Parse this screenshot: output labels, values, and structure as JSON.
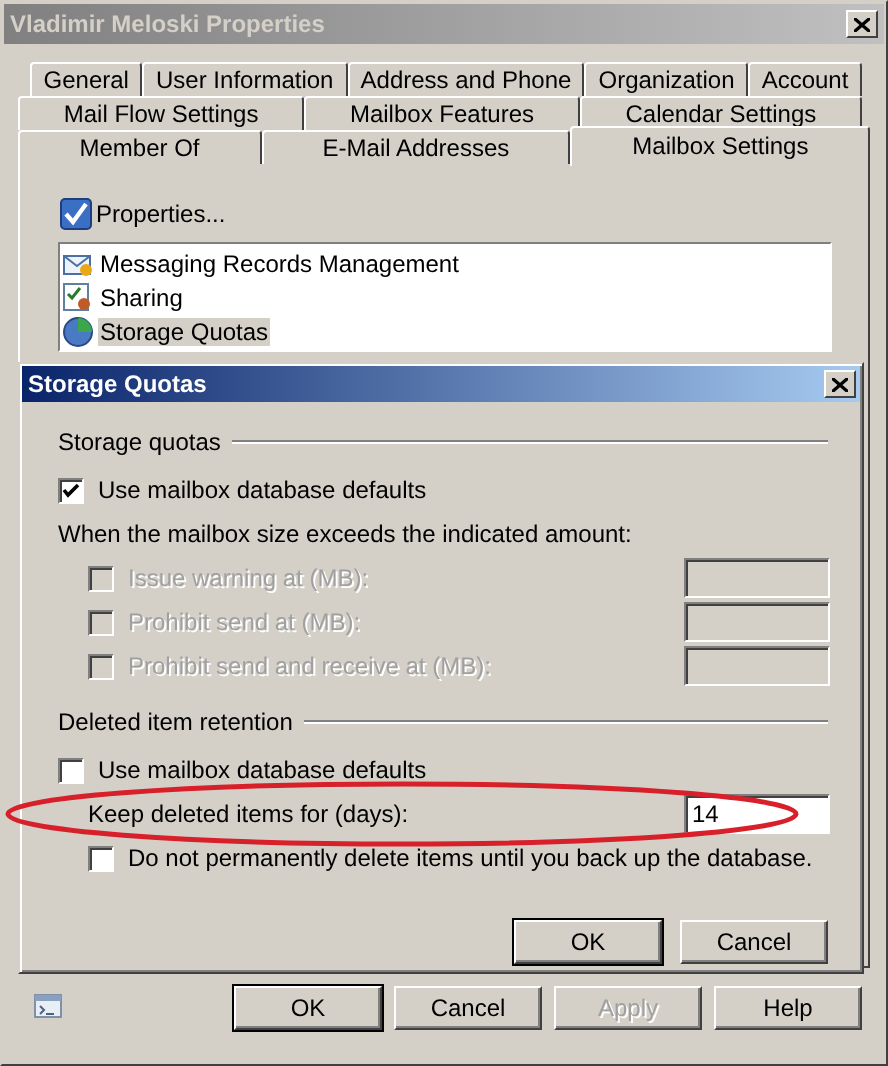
{
  "window": {
    "title": "Vladimir Meloski Properties"
  },
  "tab_rows": [
    [
      {
        "label": "General",
        "selected": false
      },
      {
        "label": "User Information",
        "selected": false
      },
      {
        "label": "Address and Phone",
        "selected": false
      },
      {
        "label": "Organization",
        "selected": false
      },
      {
        "label": "Account",
        "selected": false
      }
    ],
    [
      {
        "label": "Mail Flow Settings",
        "selected": false
      },
      {
        "label": "Mailbox Features",
        "selected": false
      },
      {
        "label": "Calendar Settings",
        "selected": false
      }
    ],
    [
      {
        "label": "Member Of",
        "selected": false
      },
      {
        "label": "E-Mail Addresses",
        "selected": false
      },
      {
        "label": "Mailbox Settings",
        "selected": true
      }
    ]
  ],
  "properties_button": {
    "label": "Properties..."
  },
  "list": [
    {
      "kind": "records",
      "label": "Messaging Records Management",
      "selected": false
    },
    {
      "kind": "sharing",
      "label": "Sharing",
      "selected": false
    },
    {
      "kind": "quota",
      "label": "Storage Quotas",
      "selected": true
    }
  ],
  "dialog": {
    "title": "Storage Quotas",
    "sections": [
      {
        "title": "Storage quotas",
        "items": [
          {
            "kind": "checkbox",
            "label": "Use mailbox database defaults",
            "checked": true,
            "disabled": false,
            "indented": false
          },
          {
            "kind": "text",
            "label": "When the mailbox size exceeds the indicated amount:"
          },
          {
            "kind": "check_field",
            "label": "Issue warning at (MB):",
            "checked": false,
            "disabled": true
          },
          {
            "kind": "check_field",
            "label": "Prohibit send at (MB):",
            "checked": false,
            "disabled": true
          },
          {
            "kind": "check_field",
            "label": "Prohibit send and receive at (MB):",
            "checked": false,
            "disabled": true
          }
        ]
      },
      {
        "title": "Deleted item retention",
        "items": [
          {
            "kind": "checkbox",
            "label": "Use mailbox database defaults",
            "checked": false,
            "disabled": false,
            "indented": false
          },
          {
            "kind": "field",
            "label": "Keep deleted items for (days):",
            "value": "14",
            "circled": true
          },
          {
            "kind": "checkbox",
            "label": "Do not permanently delete items until you back up the database.",
            "checked": false,
            "disabled": false,
            "indented": true
          }
        ]
      }
    ],
    "buttons": [
      {
        "label": "OK",
        "default": true,
        "disabled": false
      },
      {
        "label": "Cancel",
        "default": false,
        "disabled": false
      }
    ]
  },
  "buttons": [
    {
      "label": "OK",
      "default": true,
      "disabled": false
    },
    {
      "label": "Cancel",
      "default": false,
      "disabled": false
    },
    {
      "label": "Apply",
      "default": false,
      "disabled": true
    },
    {
      "label": "Help",
      "default": false,
      "disabled": false
    }
  ]
}
